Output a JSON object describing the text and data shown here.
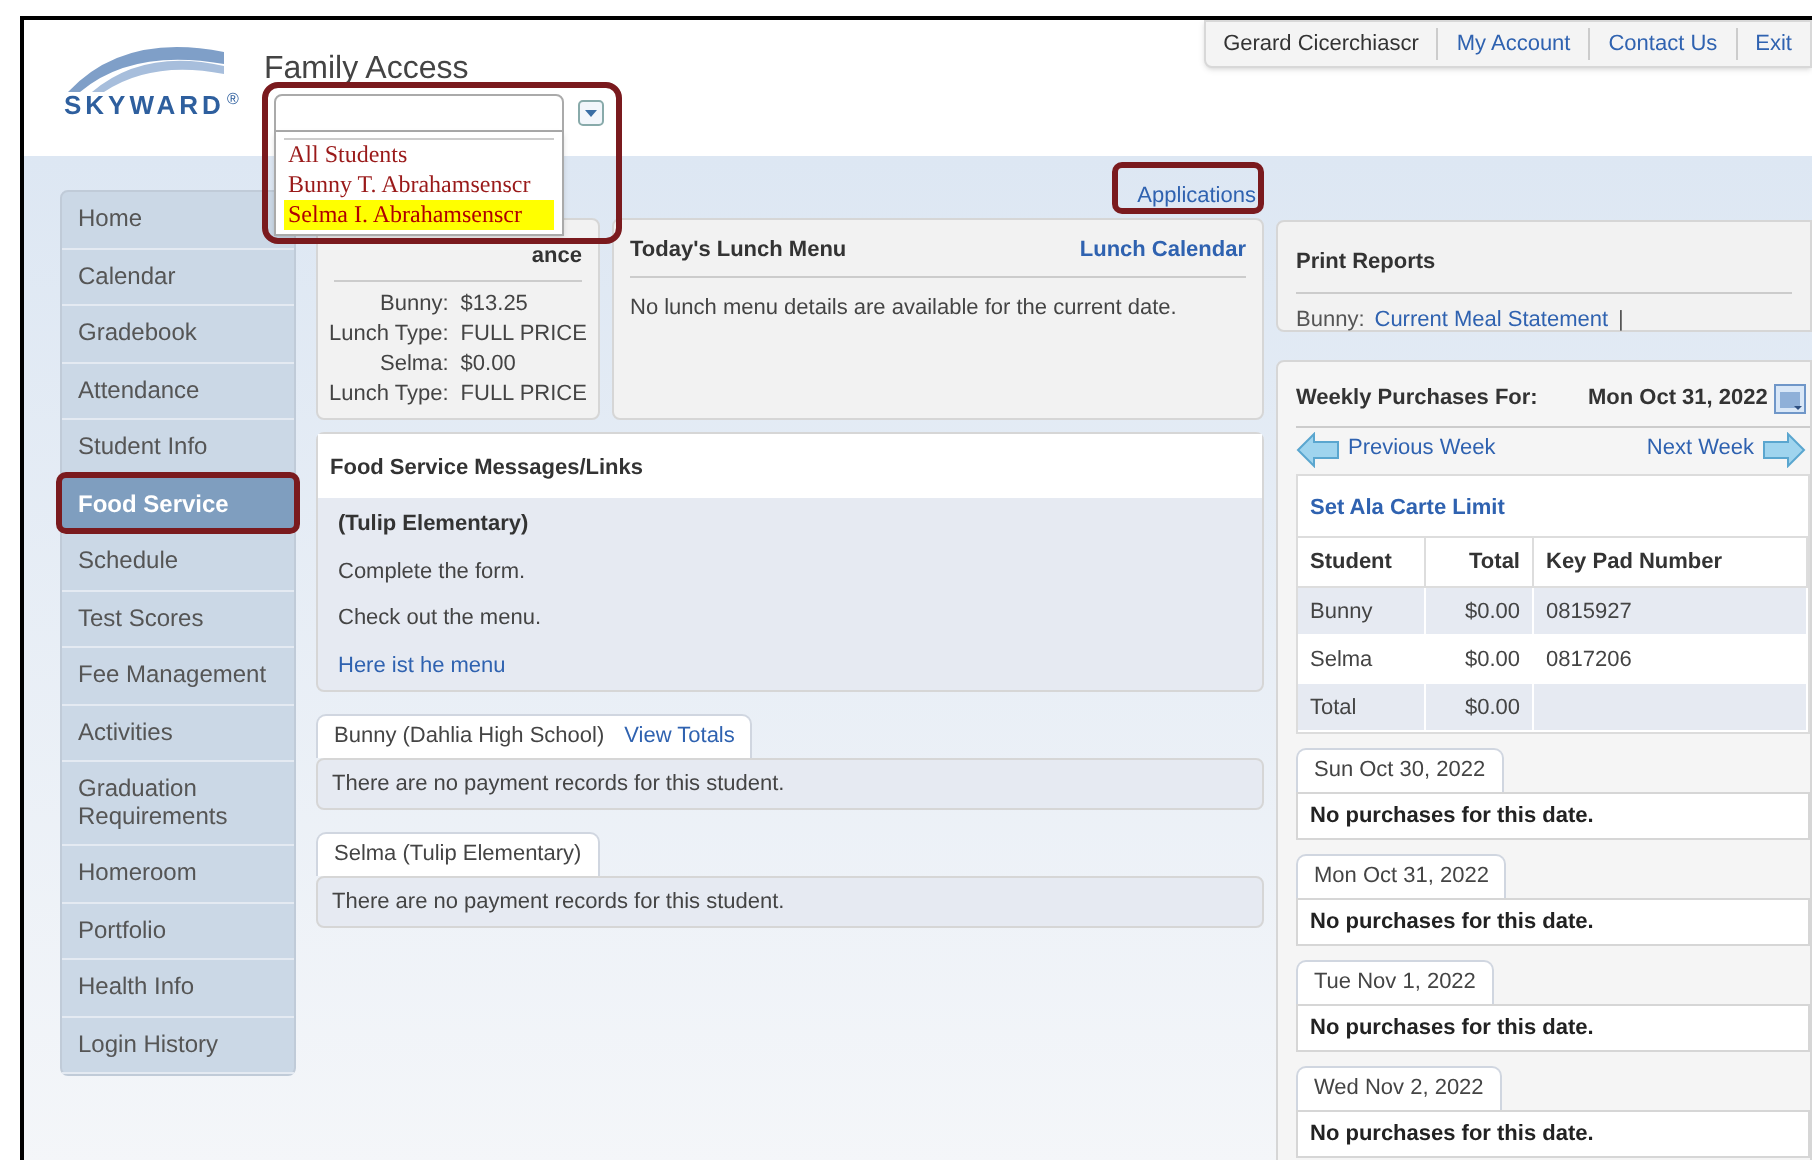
{
  "header": {
    "logo_text": "SKYWARD",
    "logo_mark": "®",
    "app_title": "Family Access",
    "user_menu": [
      {
        "label": "Gerard Cicerchiascr",
        "kind": "name"
      },
      {
        "label": "My Account",
        "kind": "link"
      },
      {
        "label": "Contact Us",
        "kind": "link"
      },
      {
        "label": "Exit",
        "kind": "link"
      }
    ]
  },
  "student_dropdown": {
    "options": [
      {
        "label": "All Students",
        "selected": false
      },
      {
        "label": "Bunny T. Abrahamsenscr",
        "selected": false
      },
      {
        "label": "Selma I. Abrahamsenscr",
        "selected": true
      }
    ]
  },
  "applications_link": "Applications",
  "sidebar": {
    "items": [
      {
        "label": "Home",
        "selected": false
      },
      {
        "label": "Calendar",
        "selected": false
      },
      {
        "label": "Gradebook",
        "selected": false
      },
      {
        "label": "Attendance",
        "selected": false
      },
      {
        "label": "Student Info",
        "selected": false
      },
      {
        "label": "Food Service",
        "selected": true
      },
      {
        "label": "Schedule",
        "selected": false
      },
      {
        "label": "Test Scores",
        "selected": false
      },
      {
        "label": "Fee Management",
        "selected": false
      },
      {
        "label": "Activities",
        "selected": false
      },
      {
        "label": "Graduation Requirements",
        "selected": false
      },
      {
        "label": "Homeroom",
        "selected": false
      },
      {
        "label": "Portfolio",
        "selected": false
      },
      {
        "label": "Health Info",
        "selected": false
      },
      {
        "label": "Login History",
        "selected": false
      }
    ]
  },
  "balance_panel": {
    "title": "ance",
    "entries": [
      {
        "label": "Bunny:",
        "value": "$13.25"
      },
      {
        "label": "Lunch Type:",
        "value": "FULL PRICE"
      },
      {
        "label": "Selma:",
        "value": "$0.00"
      },
      {
        "label": "Lunch Type:",
        "value": "FULL PRICE"
      }
    ]
  },
  "lunch_menu": {
    "title": "Today's Lunch Menu",
    "link": "Lunch Calendar",
    "message": "No lunch menu details are available for the current date."
  },
  "messages": {
    "title": "Food Service Messages/Links",
    "school": "(Tulip Elementary)",
    "lines": [
      "Complete the form.",
      "Check out the menu."
    ],
    "link": "Here ist he menu"
  },
  "payments": [
    {
      "tab": "Bunny (Dahlia High School)",
      "link": "View Totals",
      "message": "There are no payment records for this student."
    },
    {
      "tab": "Selma (Tulip Elementary)",
      "message": "There are no payment records for this student."
    }
  ],
  "print_reports": {
    "title": "Print Reports",
    "label": "Bunny:",
    "link": "Current Meal Statement",
    "separator": "|"
  },
  "weekly": {
    "title": "Weekly Purchases For:",
    "date": "Mon Oct 31, 2022",
    "previous": "Previous Week",
    "next": "Next Week",
    "ala_carte": "Set Ala Carte Limit",
    "columns": [
      "Student",
      "Total",
      "Key Pad Number"
    ],
    "rows": [
      [
        "Bunny",
        "$0.00",
        "0815927"
      ],
      [
        "Selma",
        "$0.00",
        "0817206"
      ],
      [
        "Total",
        "$0.00",
        ""
      ]
    ],
    "days": [
      {
        "date": "Sun Oct 30, 2022",
        "message": "No purchases for this date."
      },
      {
        "date": "Mon Oct 31, 2022",
        "message": "No purchases for this date."
      },
      {
        "date": "Tue Nov 1, 2022",
        "message": "No purchases for this date."
      },
      {
        "date": "Wed Nov 2, 2022",
        "message": "No purchases for this date."
      }
    ]
  }
}
